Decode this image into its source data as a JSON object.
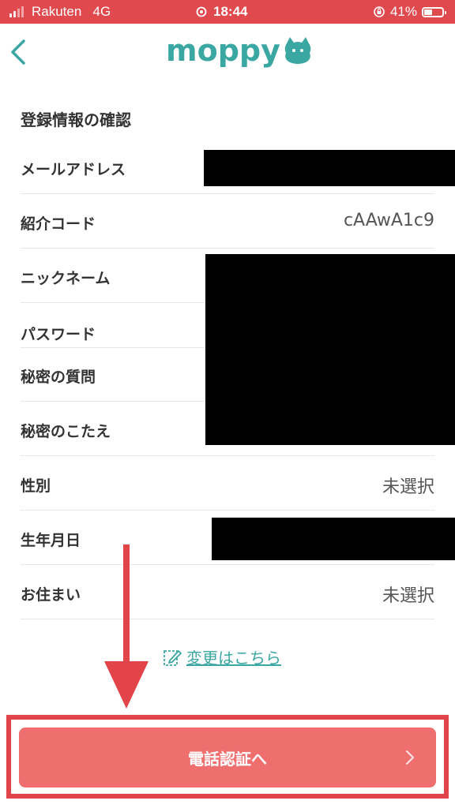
{
  "status_bar": {
    "carrier": "Rakuten",
    "network": "4G",
    "time": "18:44",
    "battery": "41%",
    "battery_level": 0.41
  },
  "header": {
    "back_icon": "chevron-left-icon",
    "logo_text": "moppy",
    "logo_icon": "moppy-mascot-icon",
    "brand_color": "#3aa7a3"
  },
  "section": {
    "title": "登録情報の確認"
  },
  "fields": [
    {
      "label": "メールアドレス",
      "value": "",
      "masked": true
    },
    {
      "label": "紹介コード",
      "value": "cAAwA1c9",
      "masked": false
    },
    {
      "label": "ニックネーム",
      "value": "",
      "masked": true
    },
    {
      "label": "パスワード",
      "value": "",
      "masked": true
    },
    {
      "label": "秘密の質問",
      "value": "",
      "masked": true
    },
    {
      "label": "秘密のこたえ",
      "value": "",
      "masked": true
    },
    {
      "label": "性別",
      "value": "未選択",
      "masked": false
    },
    {
      "label": "生年月日",
      "value": "",
      "masked": true
    },
    {
      "label": "お住まい",
      "value": "未選択",
      "masked": false
    }
  ],
  "change_link": {
    "icon": "edit-icon",
    "text": "変更はこちら"
  },
  "cta": {
    "label": "電話認証へ",
    "icon": "chevron-right-icon",
    "color": "#ef6f6f",
    "highlight_color": "#e34449"
  }
}
